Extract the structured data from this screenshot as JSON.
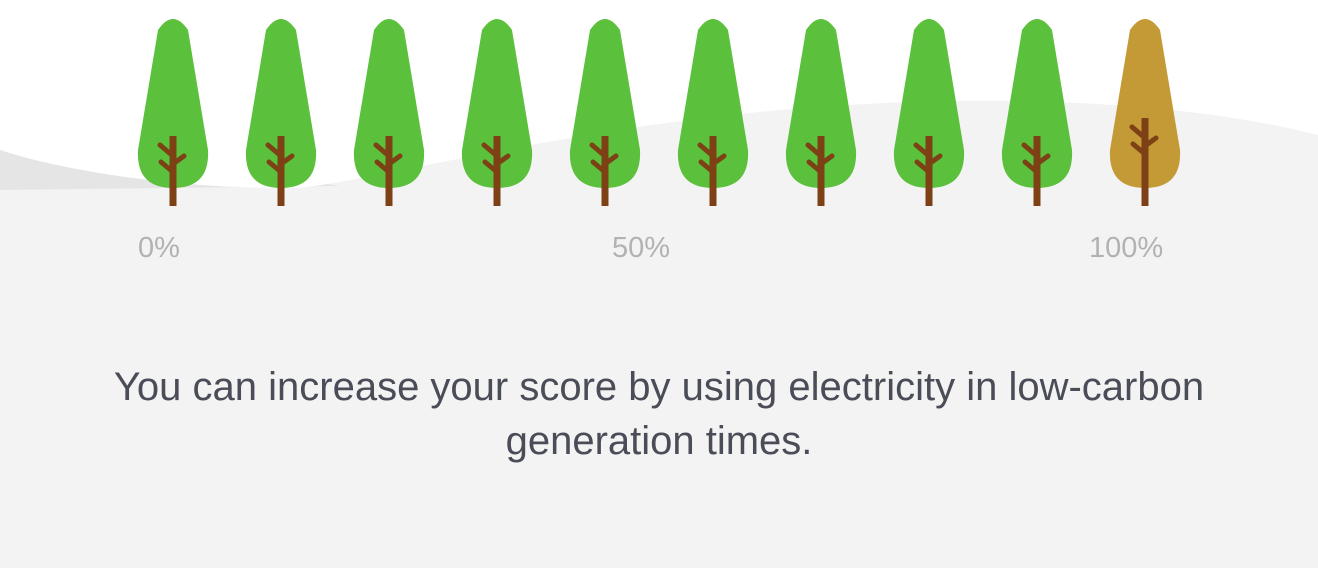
{
  "score_scale": {
    "tree_count": 10,
    "active_trees": 9,
    "labels": {
      "start": "0%",
      "middle": "50%",
      "end": "100%"
    },
    "colors": {
      "active_foliage": "#5bc13c",
      "inactive_foliage": "#c39a35",
      "trunk": "#7d4115",
      "background": "#f3f3f3",
      "hill_back": "#e5e5e5",
      "hill_front": "#ffffff"
    }
  },
  "message": "You can increase your score by using electricity in low-carbon generation times."
}
